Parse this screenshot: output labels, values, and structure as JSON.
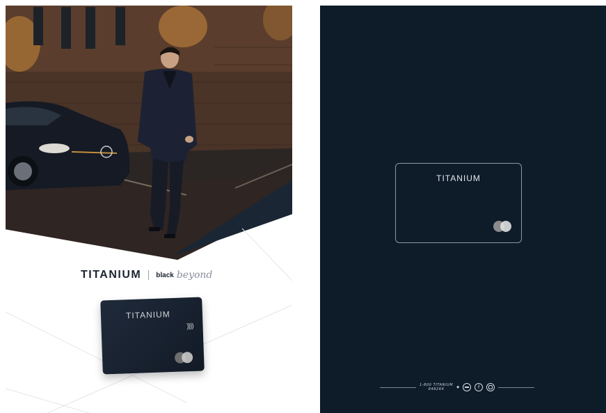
{
  "left_ad": {
    "brand": "TITANIUM",
    "black": "black",
    "beyond": "beyond",
    "card_brand": "TITANIUM",
    "nfc_symbol": "))))"
  },
  "right_ad": {
    "card_brand": "TITANIUM",
    "footer_phone_line1": "1-800 TITANIUM",
    "footer_phone_line2": "848264",
    "social_icons": [
      "phone-icon",
      "facebook-icon",
      "instagram-icon"
    ],
    "facebook_glyph": "f"
  },
  "colors": {
    "navy": "#0e1b29",
    "card": "#1a2431",
    "accent_gray": "#8a909a"
  }
}
